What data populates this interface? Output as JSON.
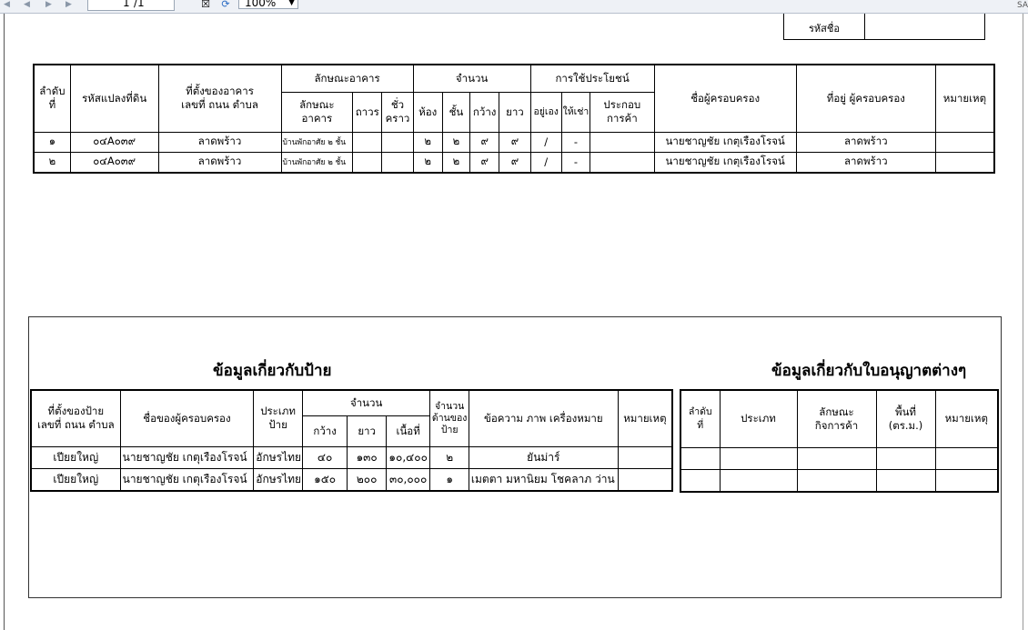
{
  "toolbar": {
    "page_current": "1",
    "page_total": "/1",
    "zoom": "100%",
    "right_label": "SA"
  },
  "tax_id": {
    "label": "รหัสชื่อ",
    "value": ""
  },
  "building_table": {
    "headers": {
      "seq": "ลำดับ\nที่",
      "parcel_code": "รหัสแปลงที่ดิน",
      "location": "ที่ตั้งของอาคาร\nเลขที่  ถนน  ตำบล",
      "characteristics": "ลักษณะอาคาร",
      "char_type": "ลักษณะ\nอาคาร",
      "char_permanent": "ถาวร",
      "char_temporary": "ชั่ว\nคราว",
      "count": "จำนวน",
      "count_rooms": "ห้อง",
      "count_floors": "ชั้น",
      "count_width": "กว้าง",
      "count_length": "ยาว",
      "usage": "การใช้ประโยชน์",
      "usage_live": "อยู่เอง",
      "usage_rent": "ให้เช่า",
      "usage_business": "ประกอบ\nการค้า",
      "owner_name": "ชื่อผู้ครอบครอง",
      "owner_address": "ที่อยู่ ผู้ครอบครอง",
      "remark": "หมายเหตุ"
    },
    "rows": [
      {
        "seq": "๑",
        "parcel": "๐๔A๐๓๙",
        "location": "ลาดพร้าว",
        "type": "บ้านพักอาศัย ๒ ชั้น",
        "permanent": "",
        "temporary": "",
        "rooms": "๒",
        "floors": "๒",
        "width": "๙",
        "length": "๙",
        "live": "/",
        "rent": "-",
        "business": "",
        "owner": "นายชาญชัย  เกตุเรืองโรจน์",
        "address": "ลาดพร้าว",
        "remark": ""
      },
      {
        "seq": "๒",
        "parcel": "๐๔A๐๓๙",
        "location": "ลาดพร้าว",
        "type": "บ้านพักอาศัย ๒ ชั้น",
        "permanent": "",
        "temporary": "",
        "rooms": "๒",
        "floors": "๒",
        "width": "๙",
        "length": "๙",
        "live": "/",
        "rent": "-",
        "business": "",
        "owner": "นายชาญชัย  เกตุเรืองโรจน์",
        "address": "ลาดพร้าว",
        "remark": ""
      }
    ]
  },
  "sign_section": {
    "title": "ข้อมูลเกี่ยวกับป้าย",
    "headers": {
      "location": "ที่ตั้งของป้าย\nเลขที่ ถนน ตำบล",
      "owner": "ชื่อของผู้ครอบครอง",
      "type": "ประเภท\nป้าย",
      "count": "จำนวน",
      "width": "กว้าง",
      "length": "ยาว",
      "area": "เนื้อที่",
      "sides": "จำนวน\nด้านของ\nป้าย",
      "text": "ข้อความ ภาพ เครื่องหมาย",
      "remark": "หมายเหตุ"
    },
    "rows": [
      {
        "location": "เปียยใหญ่",
        "owner": "นายชาญชัย   เกตุเรืองโรจน์",
        "type": "อักษรไทยล้วน",
        "width": "๔๐",
        "length": "๑๓๐",
        "area": "๑๐,๔๐๐",
        "sides": "๒",
        "text": "ยันม่าร์",
        "remark": ""
      },
      {
        "location": "เปียยใหญ่",
        "owner": "นายชาญชัย   เกตุเรืองโรจน์",
        "type": "อักษรไทยล้วน",
        "width": "๑๕๐",
        "length": "๒๐๐",
        "area": "๓๐,๐๐๐",
        "sides": "๑",
        "text": "เมตตา มหานิยม โชคลาภ  ว่าน",
        "remark": ""
      }
    ]
  },
  "license_section": {
    "title": "ข้อมูลเกี่ยวกับใบอนุญาตต่างๆ",
    "headers": {
      "seq": "ลำดับ\nที่",
      "type": "ประเภท",
      "business": "ลักษณะ\nกิจการค้า",
      "area": "พื้นที่\n(ตร.ม.)",
      "remark": "หมายเหตุ"
    },
    "rows": [
      {
        "seq": "",
        "type": "",
        "business": "",
        "area": "",
        "remark": ""
      },
      {
        "seq": "",
        "type": "",
        "business": "",
        "area": "",
        "remark": ""
      }
    ]
  }
}
